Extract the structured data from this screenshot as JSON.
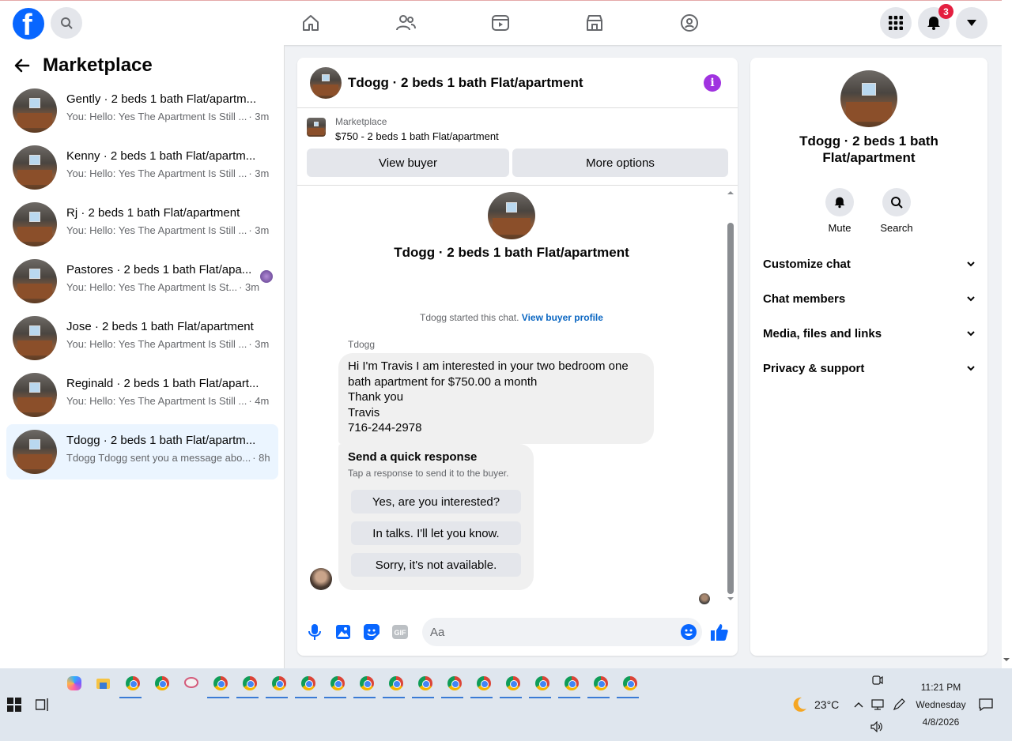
{
  "topnav": {
    "logo_letter": "f",
    "notification_count": "3"
  },
  "sidebar": {
    "title": "Marketplace",
    "conversations": [
      {
        "name": "Gently · 2 beds 1 bath Flat/apartm...",
        "preview": "You: Hello: Yes The Apartment Is Still ...",
        "time": "· 3m"
      },
      {
        "name": "Kenny · 2 beds 1 bath Flat/apartm...",
        "preview": "You: Hello: Yes The Apartment Is Still ...",
        "time": "· 3m"
      },
      {
        "name": "Rj · 2 beds 1 bath Flat/apartment",
        "preview": "You: Hello: Yes The Apartment Is Still ...",
        "time": "· 3m"
      },
      {
        "name": "Pastores · 2 beds 1 bath Flat/apa...",
        "preview": "You: Hello: Yes The Apartment Is St...",
        "time": "· 3m"
      },
      {
        "name": "Jose · 2 beds 1 bath Flat/apartment",
        "preview": "You: Hello: Yes The Apartment Is Still ...",
        "time": "· 3m"
      },
      {
        "name": "Reginald · 2 beds 1 bath Flat/apart...",
        "preview": "You: Hello: Yes The Apartment Is Still ...",
        "time": "· 4m"
      },
      {
        "name": "Tdogg · 2 beds 1 bath Flat/apartm...",
        "preview": "Tdogg Tdogg sent you a message abo...",
        "time": "· 8h"
      }
    ]
  },
  "chat": {
    "title": "Tdogg · 2 beds 1 bath Flat/apartment",
    "marketplace_label": "Marketplace",
    "listing": "$750 - 2 beds 1 bath Flat/apartment",
    "view_buyer": "View buyer",
    "more_options": "More options",
    "thread_title": "Tdogg · 2 beds 1 bath Flat/apartment",
    "started_text": "Tdogg started this chat.",
    "view_buyer_profile": "View buyer profile",
    "sender": "Tdogg",
    "message_lines": [
      "Hi I'm Travis I am interested in your two bedroom one",
      "bath apartment for $750.00 a month",
      "Thank you",
      "Travis",
      "716-244-2978"
    ],
    "quick_response": {
      "title": "Send a quick response",
      "subtitle": "Tap a response to send it to the buyer.",
      "options": [
        "Yes, are you interested?",
        "In talks. I'll let you know.",
        "Sorry, it's not available."
      ]
    },
    "input_placeholder": "Aa"
  },
  "right_panel": {
    "name_line1": "Tdogg · 2 beds 1 bath",
    "name_line2": "Flat/apartment",
    "mute": "Mute",
    "search": "Search",
    "sections": [
      "Customize chat",
      "Chat members",
      "Media, files and links",
      "Privacy & support"
    ]
  },
  "taskbar": {
    "temperature": "23°C",
    "time": "11:21 PM",
    "day": "Wednesday",
    "date": "4/8/2026"
  }
}
